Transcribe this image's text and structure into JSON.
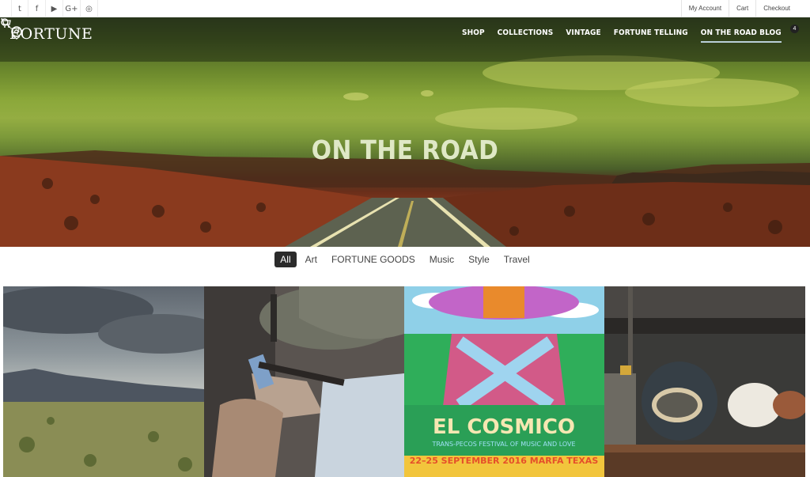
{
  "topbar": {
    "social_icons": [
      "twitter-icon",
      "facebook-icon",
      "youtube-icon",
      "googleplus-icon",
      "instagram-icon"
    ],
    "social_glyphs": [
      "t",
      "f",
      "▶",
      "G+",
      "◎"
    ],
    "account_links": [
      "My Account",
      "Cart",
      "Checkout"
    ]
  },
  "header": {
    "logo_text": "FORTUNE",
    "nav": [
      "SHOP",
      "COLLECTIONS",
      "VINTAGE",
      "FORTUNE TELLING",
      "ON THE ROAD BLOG"
    ],
    "active_nav": "ON THE ROAD BLOG",
    "cart_count": "4"
  },
  "hero": {
    "title": "ON THE ROAD"
  },
  "filters": {
    "items": [
      "All",
      "Art",
      "FORTUNE GOODS",
      "Music",
      "Style",
      "Travel"
    ],
    "active": "All"
  },
  "posts": {
    "poster_title": "EL COSMICO",
    "poster_subtitle": "TRANS-PECOS FESTIVAL OF MUSIC AND LOVE",
    "poster_date": "22–25 SEPTEMBER 2016  MARFA TEXAS"
  },
  "colors": {
    "accent_dark": "#2b2b2b",
    "nav_underline": "#b9cfd8"
  }
}
